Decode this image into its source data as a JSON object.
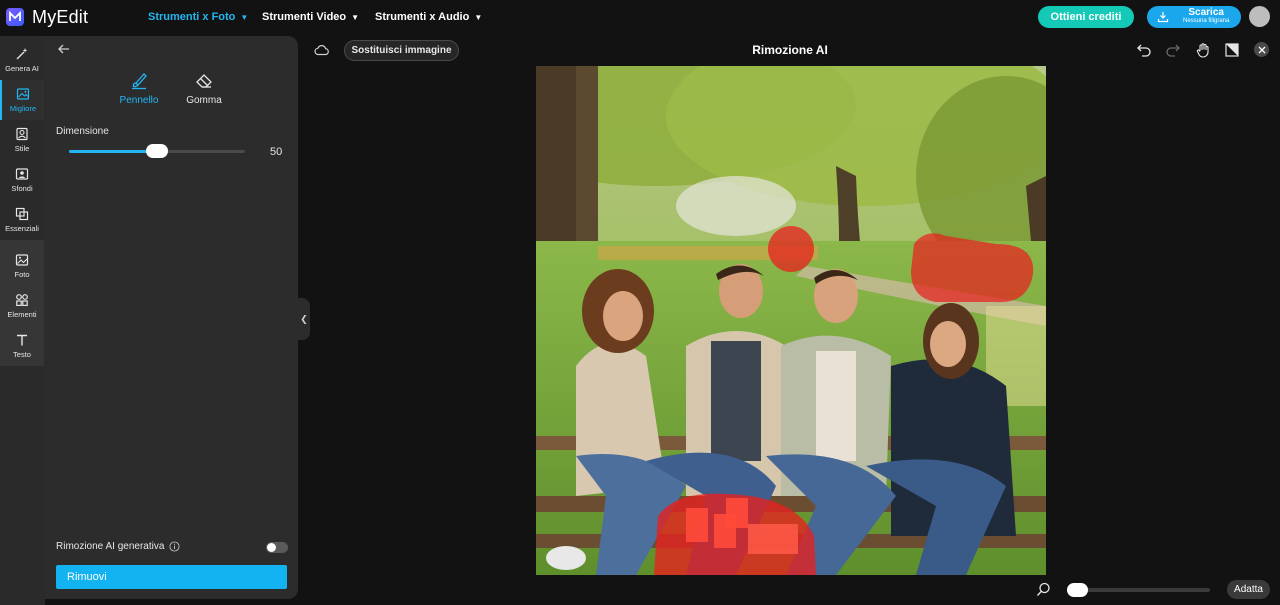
{
  "app": {
    "name": "MyEdit"
  },
  "nav": [
    {
      "label": "Strumenti x Foto",
      "active": true
    },
    {
      "label": "Strumenti Video",
      "active": false
    },
    {
      "label": "Strumenti x Audio",
      "active": false
    }
  ],
  "header": {
    "credits_label": "Ottieni crediti",
    "download_label": "Scarica",
    "download_sub": "Nessuna filigrana"
  },
  "rail": [
    {
      "label": "Genera AI",
      "icon": "magic-wand-icon"
    },
    {
      "label": "Migliore",
      "icon": "image-enhance-icon",
      "active": true
    },
    {
      "label": "Stile",
      "icon": "portrait-style-icon"
    },
    {
      "label": "Sfondi",
      "icon": "background-icon"
    },
    {
      "label": "Essenziali",
      "icon": "crop-icon"
    },
    {
      "label": "Foto",
      "icon": "photo-icon"
    },
    {
      "label": "Elementi",
      "icon": "elements-icon"
    },
    {
      "label": "Testo",
      "icon": "text-icon"
    }
  ],
  "panel": {
    "tools": [
      {
        "label": "Pennello",
        "icon": "brush-icon",
        "active": true
      },
      {
        "label": "Gomma",
        "icon": "eraser-icon",
        "active": false
      }
    ],
    "dimension_label": "Dimensione",
    "dimension_value": "50",
    "dimension_fraction": 0.5,
    "generative_label": "Rimozione AI generativa",
    "generative_enabled": false,
    "remove_label": "Rimuovi"
  },
  "canvas_bar": {
    "replace_label": "Sostituisci immagine",
    "title": "Rimozione AI"
  },
  "bottom": {
    "fit_label": "Adatta",
    "zoom_fraction": 0.0
  },
  "colors": {
    "accent": "#22b6f2",
    "credits": "#14c9b6",
    "download": "#1aa7ec",
    "mask": "#e8201e"
  }
}
